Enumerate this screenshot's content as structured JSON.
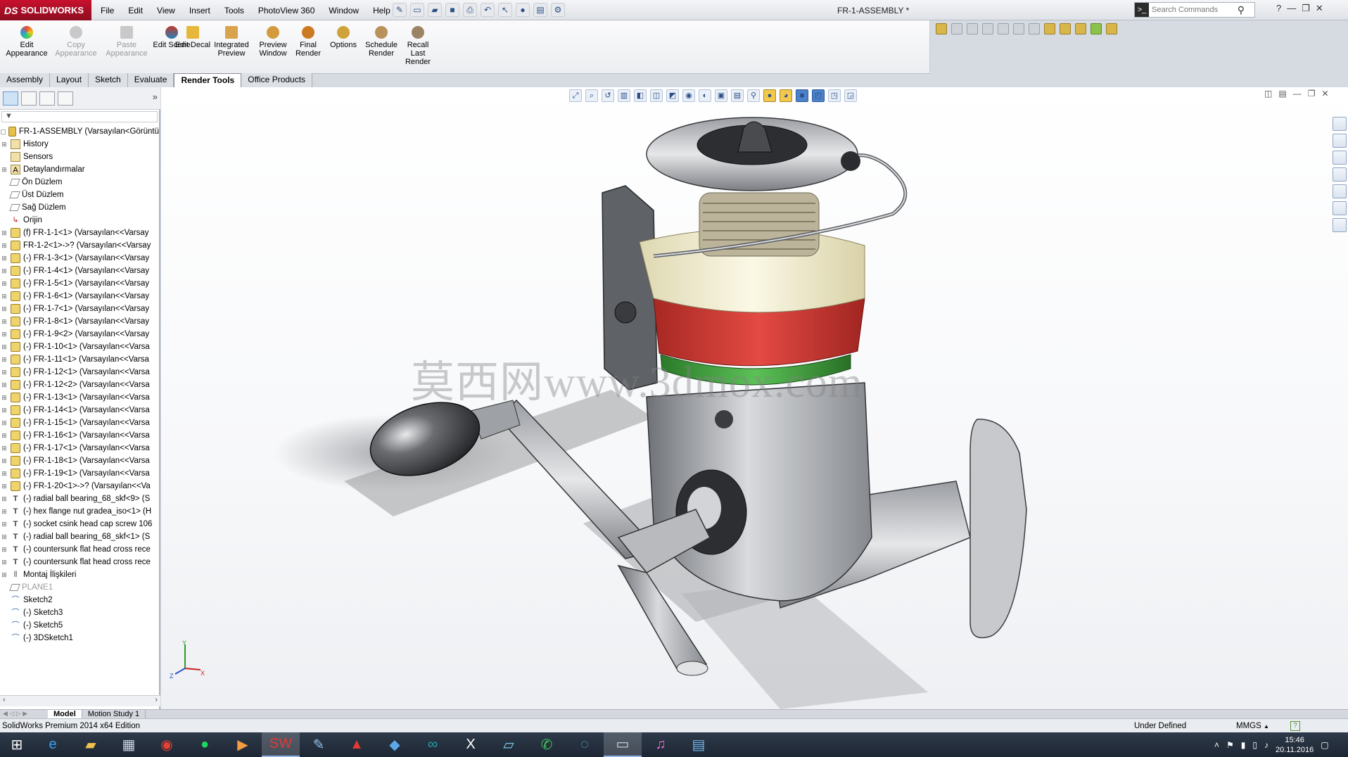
{
  "titlebar": {
    "brand": "SOLIDWORKS",
    "menus": [
      "File",
      "Edit",
      "View",
      "Insert",
      "Tools",
      "PhotoView 360",
      "Window",
      "Help"
    ],
    "doc_title": "FR-1-ASSEMBLY *",
    "search_placeholder": "Search Commands"
  },
  "command_manager": {
    "buttons": [
      {
        "label": "Edit Appearance",
        "enabled": true,
        "icon": "appearance-ball-icon"
      },
      {
        "label": "Copy Appearance",
        "enabled": false,
        "icon": "copy-appearance-icon"
      },
      {
        "label": "Paste Appearance",
        "enabled": false,
        "icon": "paste-appearance-icon"
      },
      {
        "label": "Edit Scene",
        "enabled": true,
        "icon": "scene-icon"
      },
      {
        "label": "Edit Decal",
        "enabled": true,
        "icon": "decal-icon"
      },
      {
        "label": "Integrated Preview",
        "enabled": true,
        "icon": "integrated-preview-icon"
      },
      {
        "label": "Preview Window",
        "enabled": true,
        "icon": "preview-window-icon"
      },
      {
        "label": "Final Render",
        "enabled": true,
        "icon": "final-render-icon"
      },
      {
        "label": "Options",
        "enabled": true,
        "icon": "options-icon"
      },
      {
        "label": "Schedule Render",
        "enabled": true,
        "icon": "schedule-render-icon"
      },
      {
        "label": "Recall Last Render",
        "enabled": true,
        "icon": "recall-render-icon"
      }
    ]
  },
  "tabs": [
    "Assembly",
    "Layout",
    "Sketch",
    "Evaluate",
    "Render Tools",
    "Office Products"
  ],
  "active_tab": "Render Tools",
  "feature_tree": {
    "root": "FR-1-ASSEMBLY  (Varsayılan<Görüntü",
    "items": [
      {
        "label": "History",
        "icon": "history-folder-icon",
        "expand": true
      },
      {
        "label": "Sensors",
        "icon": "sensors-icon",
        "expand": false
      },
      {
        "label": "Detaylandırmalar",
        "icon": "annotations-icon",
        "expand": true
      },
      {
        "label": "Ön Düzlem",
        "icon": "plane-icon",
        "expand": false
      },
      {
        "label": "Üst Düzlem",
        "icon": "plane-icon",
        "expand": false
      },
      {
        "label": "Sağ Düzlem",
        "icon": "plane-icon",
        "expand": false
      },
      {
        "label": "Orijin",
        "icon": "origin-icon",
        "expand": false
      },
      {
        "label": "(f) FR-1-1<1> (Varsayılan<<Varsay",
        "icon": "part-icon",
        "expand": true
      },
      {
        "label": "FR-1-2<1>->? (Varsayılan<<Varsay",
        "icon": "part-icon",
        "expand": true
      },
      {
        "label": "(-) FR-1-3<1> (Varsayılan<<Varsay",
        "icon": "part-icon",
        "expand": true
      },
      {
        "label": "(-) FR-1-4<1> (Varsayılan<<Varsay",
        "icon": "part-icon",
        "expand": true
      },
      {
        "label": "(-) FR-1-5<1> (Varsayılan<<Varsay",
        "icon": "part-icon",
        "expand": true
      },
      {
        "label": "(-) FR-1-6<1> (Varsayılan<<Varsay",
        "icon": "part-icon",
        "expand": true
      },
      {
        "label": "(-) FR-1-7<1> (Varsayılan<<Varsay",
        "icon": "part-icon",
        "expand": true
      },
      {
        "label": "(-) FR-1-8<1> (Varsayılan<<Varsay",
        "icon": "part-icon",
        "expand": true
      },
      {
        "label": "(-) FR-1-9<2> (Varsayılan<<Varsay",
        "icon": "part-icon",
        "expand": true
      },
      {
        "label": "(-) FR-1-10<1> (Varsayılan<<Varsa",
        "icon": "part-icon",
        "expand": true
      },
      {
        "label": "(-) FR-1-11<1> (Varsayılan<<Varsa",
        "icon": "part-icon",
        "expand": true
      },
      {
        "label": "(-) FR-1-12<1> (Varsayılan<<Varsa",
        "icon": "part-icon",
        "expand": true
      },
      {
        "label": "(-) FR-1-12<2> (Varsayılan<<Varsa",
        "icon": "part-icon",
        "expand": true
      },
      {
        "label": "(-) FR-1-13<1> (Varsayılan<<Varsa",
        "icon": "part-icon",
        "expand": true
      },
      {
        "label": "(-) FR-1-14<1> (Varsayılan<<Varsa",
        "icon": "part-icon",
        "expand": true
      },
      {
        "label": "(-) FR-1-15<1> (Varsayılan<<Varsa",
        "icon": "part-icon",
        "expand": true
      },
      {
        "label": "(-) FR-1-16<1> (Varsayılan<<Varsa",
        "icon": "part-icon",
        "expand": true
      },
      {
        "label": "(-) FR-1-17<1> (Varsayılan<<Varsa",
        "icon": "part-icon",
        "expand": true
      },
      {
        "label": "(-) FR-1-18<1> (Varsayılan<<Varsa",
        "icon": "part-icon",
        "expand": true
      },
      {
        "label": "(-) FR-1-19<1> (Varsayılan<<Varsa",
        "icon": "part-icon",
        "expand": true
      },
      {
        "label": "(-) FR-1-20<1>->? (Varsayılan<<Va",
        "icon": "part-icon",
        "expand": true
      },
      {
        "label": "(-) radial ball bearing_68_skf<9> (S",
        "icon": "toolbox-part-icon",
        "expand": true
      },
      {
        "label": "(-) hex flange nut gradea_iso<1> (H",
        "icon": "toolbox-part-icon",
        "expand": true
      },
      {
        "label": "(-) socket csink head cap screw 106",
        "icon": "toolbox-part-icon",
        "expand": true
      },
      {
        "label": "(-) radial ball bearing_68_skf<1> (S",
        "icon": "toolbox-part-icon",
        "expand": true
      },
      {
        "label": "(-) countersunk flat head cross rece",
        "icon": "toolbox-part-icon",
        "expand": true
      },
      {
        "label": "(-) countersunk flat head cross rece",
        "icon": "toolbox-part-icon",
        "expand": true
      },
      {
        "label": "Montaj İlişkileri",
        "icon": "mates-icon",
        "expand": true
      },
      {
        "label": "PLANE1",
        "icon": "plane-icon",
        "expand": false,
        "gray": true
      },
      {
        "label": "Sketch2",
        "icon": "sketch-icon",
        "expand": false
      },
      {
        "label": "(-) Sketch3",
        "icon": "sketch-icon",
        "expand": false
      },
      {
        "label": "(-) Sketch5",
        "icon": "sketch-icon",
        "expand": false
      },
      {
        "label": "(-) 3DSketch1",
        "icon": "3dsketch-icon",
        "expand": false
      }
    ]
  },
  "viewport": {
    "watermark": "莫西网www.3dmox.com",
    "triad": {
      "x": "X",
      "y": "Y",
      "z": "Z"
    }
  },
  "bottom_tabs": [
    "Model",
    "Motion Study 1"
  ],
  "status": {
    "left": "SolidWorks Premium 2014 x64 Edition",
    "definition": "Under Defined",
    "units": "MMGS",
    "units_arrow": "▲"
  },
  "taskbar": {
    "apps": [
      "edge-icon",
      "explorer-icon",
      "calculator-icon",
      "chrome-icon",
      "spotify-icon",
      "media-player-icon",
      "solidworks-icon",
      "paint-icon",
      "acrobat-icon",
      "fusion-icon",
      "arduino-icon",
      "x-app-icon",
      "notepad-icon",
      "whatsapp-icon",
      "cortana-icon",
      "remote-desktop-icon",
      "itunes-icon",
      "settings-app-icon"
    ],
    "clock_time": "15:46",
    "clock_date": "20.11.2016"
  },
  "colors": {
    "brand_red": "#c8102e",
    "selection_blue": "#cfe3f7",
    "spool_red": "#d53a35",
    "spool_green": "#3f9a3a",
    "spool_cream": "#f4efcf"
  }
}
